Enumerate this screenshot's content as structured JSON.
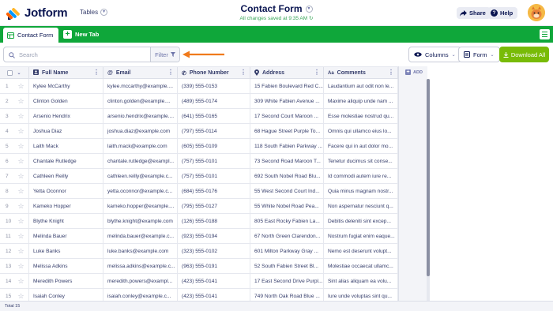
{
  "header": {
    "logo_text": "Jotform",
    "tables_label": "Tables",
    "form_title": "Contact Form",
    "saved_status": "All changes saved at 9:35 AM",
    "share_label": "Share",
    "help_label": "Help"
  },
  "tabs": {
    "active_tab": "Contact Form",
    "new_tab_label": "New Tab"
  },
  "toolbar": {
    "search_placeholder": "Search",
    "filter_label": "Filter",
    "columns_label": "Columns",
    "form_label": "Form",
    "download_label": "Download All"
  },
  "table": {
    "columns": [
      {
        "label": "Full Name",
        "icon": "person-icon"
      },
      {
        "label": "Email",
        "icon": "at-icon"
      },
      {
        "label": "Phone Number",
        "icon": "phone-icon"
      },
      {
        "label": "Address",
        "icon": "location-icon"
      },
      {
        "label": "Comments",
        "icon": "text-icon"
      }
    ],
    "add_label": "ADD",
    "rows": [
      {
        "num": "1",
        "name": "Kylee McCarthy",
        "email": "kylee.mccarthy@example....",
        "phone": "(339) 555-0153",
        "address": "15 Fabien Boulevard Red C...",
        "comments": "Laudantium aut odit non le..."
      },
      {
        "num": "2",
        "name": "Clinton Golden",
        "email": "clinton.golden@example....",
        "phone": "(489) 555-0174",
        "address": "309 White Fabien Avenue ...",
        "comments": "Maxime aliquip unde nam ..."
      },
      {
        "num": "3",
        "name": "Arsenio Hendrix",
        "email": "arsenio.hendrix@example....",
        "phone": "(641) 555-0165",
        "address": "17 Second Court Maroon ...",
        "comments": "Esse molestiae nostrud qu..."
      },
      {
        "num": "4",
        "name": "Joshua Diaz",
        "email": "joshua.diaz@example.com",
        "phone": "(797) 555-0114",
        "address": "68 Hague Street Purple To...",
        "comments": "Omnis qui ullamco eius lo..."
      },
      {
        "num": "5",
        "name": "Laith Mack",
        "email": "laith.mack@example.com",
        "phone": "(605) 555-0109",
        "address": "118 South Fabien Parkway ...",
        "comments": "Facere qui in aut dolor mo..."
      },
      {
        "num": "6",
        "name": "Chantale Rutledge",
        "email": "chantale.rutledge@exampl...",
        "phone": "(757) 555-0101",
        "address": "73 Second Road Maroon T...",
        "comments": "Tenetur ducimus sit conse..."
      },
      {
        "num": "7",
        "name": "Cathleen Reilly",
        "email": "cathleen.reilly@example.c...",
        "phone": "(757) 555-0101",
        "address": "692 South Nobel Road Blu...",
        "comments": "Id commodi autem iure re..."
      },
      {
        "num": "8",
        "name": "Yetta Oconnor",
        "email": "yetta.oconnor@example.c...",
        "phone": "(684) 555-0176",
        "address": "55 West Second Court Ind...",
        "comments": "Quia minus magnam nostr..."
      },
      {
        "num": "9",
        "name": "Kameko Hopper",
        "email": "kameko.hopper@example....",
        "phone": "(795) 555-0127",
        "address": "55 White Nobel Road Pea...",
        "comments": "Non aspernatur nesciunt q..."
      },
      {
        "num": "10",
        "name": "Blythe Knight",
        "email": "blythe.knight@example.com",
        "phone": "(126) 555-0188",
        "address": "805 East Rocky Fabien La...",
        "comments": "Debitis deleniti sint excep..."
      },
      {
        "num": "11",
        "name": "Melinda Bauer",
        "email": "melinda.bauer@example.c...",
        "phone": "(923) 555-0194",
        "address": "67 North Green Clarendon...",
        "comments": "Nostrum fugiat enim eaque..."
      },
      {
        "num": "12",
        "name": "Luke Banks",
        "email": "luke.banks@example.com",
        "phone": "(323) 555-0102",
        "address": "601 Milton Parkway Gray ...",
        "comments": "Nemo est deserunt volupt..."
      },
      {
        "num": "13",
        "name": "Melissa Adkins",
        "email": "melissa.adkins@example.c...",
        "phone": "(963) 555-0191",
        "address": "52 South Fabien Street Bl...",
        "comments": "Molestiae occaecat ullamc..."
      },
      {
        "num": "14",
        "name": "Meredith Powers",
        "email": "meredith.powers@exampl...",
        "phone": "(423) 555-0141",
        "address": "17 East Second Drive Purpl...",
        "comments": "Sint alias aliquam ea volu..."
      },
      {
        "num": "15",
        "name": "Isaiah Conley",
        "email": "isaiah.conley@example.c...",
        "phone": "(423) 555-0141",
        "address": "749 North Oak Road Blue ...",
        "comments": "Iure unde voluptas sint qu..."
      }
    ]
  },
  "footer": {
    "total_label": "Total 15"
  },
  "colors": {
    "brand_green": "#0fa73a",
    "download_green": "#78bb07",
    "annotation_arrow": "#f07a1c",
    "navy": "#0a1551"
  }
}
